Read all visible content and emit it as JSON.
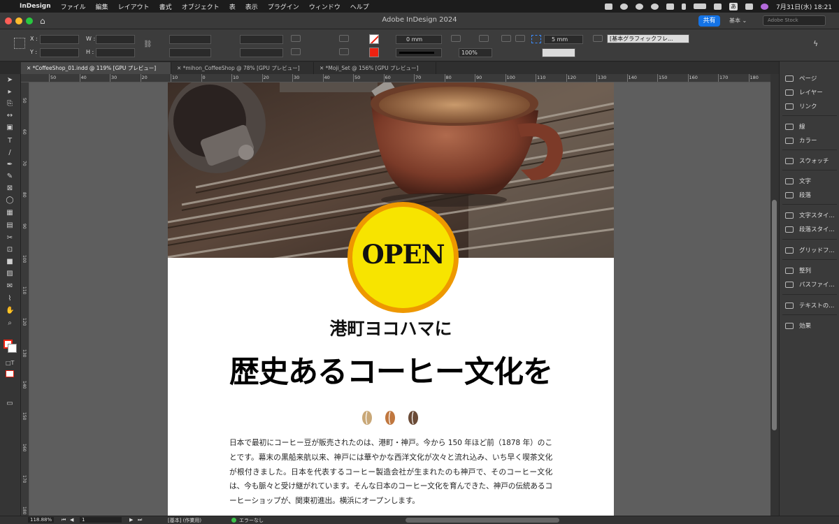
{
  "menubar": {
    "app": "InDesign",
    "items": [
      "ファイル",
      "編集",
      "レイアウト",
      "書式",
      "オブジェクト",
      "表",
      "表示",
      "プラグイン",
      "ウィンドウ",
      "ヘルプ"
    ],
    "input_indicator": "あ",
    "datetime": "7月31日(水) 18:21"
  },
  "titlebar": {
    "title": "Adobe InDesign 2024",
    "share": "共有",
    "workspace": "基本",
    "search_placeholder": "Adobe Stock"
  },
  "control": {
    "x_label": "X :",
    "y_label": "Y :",
    "w_label": "W :",
    "h_label": "H :",
    "stroke_weight": "0 mm",
    "scale": "100%",
    "spacing": "5 mm",
    "object_style": "[基本グラフィックフレ..."
  },
  "tabs": [
    "*CoffeeShop_01.indd @ 119% [GPU プレビュー]",
    "*mihon_CoffeeShop @ 78% [GPU プレビュー]",
    "*Moji_Set @ 156% [GPU プレビュー]"
  ],
  "ruler": {
    "h_labels": [
      "50",
      "40",
      "30",
      "20",
      "10",
      "0",
      "10",
      "20",
      "30",
      "40",
      "50",
      "60",
      "70",
      "80",
      "90",
      "100",
      "110",
      "120",
      "130",
      "140",
      "150",
      "160",
      "170",
      "180",
      "190"
    ],
    "v_labels": [
      "50",
      "60",
      "70",
      "80",
      "90",
      "100",
      "110",
      "120",
      "130",
      "140",
      "150",
      "160",
      "170",
      "180"
    ]
  },
  "document": {
    "badge_text": "OPEN",
    "sub_heading": "港町ヨコハマに",
    "main_heading": "歴史あるコーヒー文化を",
    "bean_colors": [
      "#c9a878",
      "#c0773f",
      "#6a4a36"
    ],
    "body": "日本で最初にコーヒー豆が販売されたのは、港町・神戸。今から 150 年ほど前（1878 年）のことです。幕末の黒船来航以来、神戸には華やかな西洋文化が次々と流れ込み、いち早く喫茶文化が根付きました。日本を代表するコーヒー製造会社が生まれたのも神戸で、そのコーヒー文化は、今も脈々と受け継がれています。そんな日本のコーヒー文化を育んできた、神戸の伝統あるコーヒーショップが、関東初進出。横浜にオープンします。"
  },
  "panels": [
    {
      "label": "ページ",
      "icon": "pages-icon"
    },
    {
      "label": "レイヤー",
      "icon": "layers-icon"
    },
    {
      "label": "リンク",
      "icon": "links-icon"
    },
    {
      "label": "線",
      "icon": "stroke-icon"
    },
    {
      "label": "カラー",
      "icon": "color-icon"
    },
    {
      "label": "スウォッチ",
      "icon": "swatches-icon"
    },
    {
      "label": "文字",
      "icon": "character-icon"
    },
    {
      "label": "段落",
      "icon": "paragraph-icon"
    },
    {
      "label": "文字スタイ...",
      "icon": "character-styles-icon"
    },
    {
      "label": "段落スタイ...",
      "icon": "paragraph-styles-icon"
    },
    {
      "label": "グリッドフ...",
      "icon": "grid-format-icon"
    },
    {
      "label": "整列",
      "icon": "align-icon"
    },
    {
      "label": "パスファイ...",
      "icon": "pathfinder-icon"
    },
    {
      "label": "テキストの...",
      "icon": "text-wrap-icon"
    },
    {
      "label": "効果",
      "icon": "effects-icon"
    }
  ],
  "statusbar": {
    "zoom": "118.88%",
    "page": "1",
    "profile": "[基本] (作業用)",
    "preflight": "エラーなし"
  }
}
